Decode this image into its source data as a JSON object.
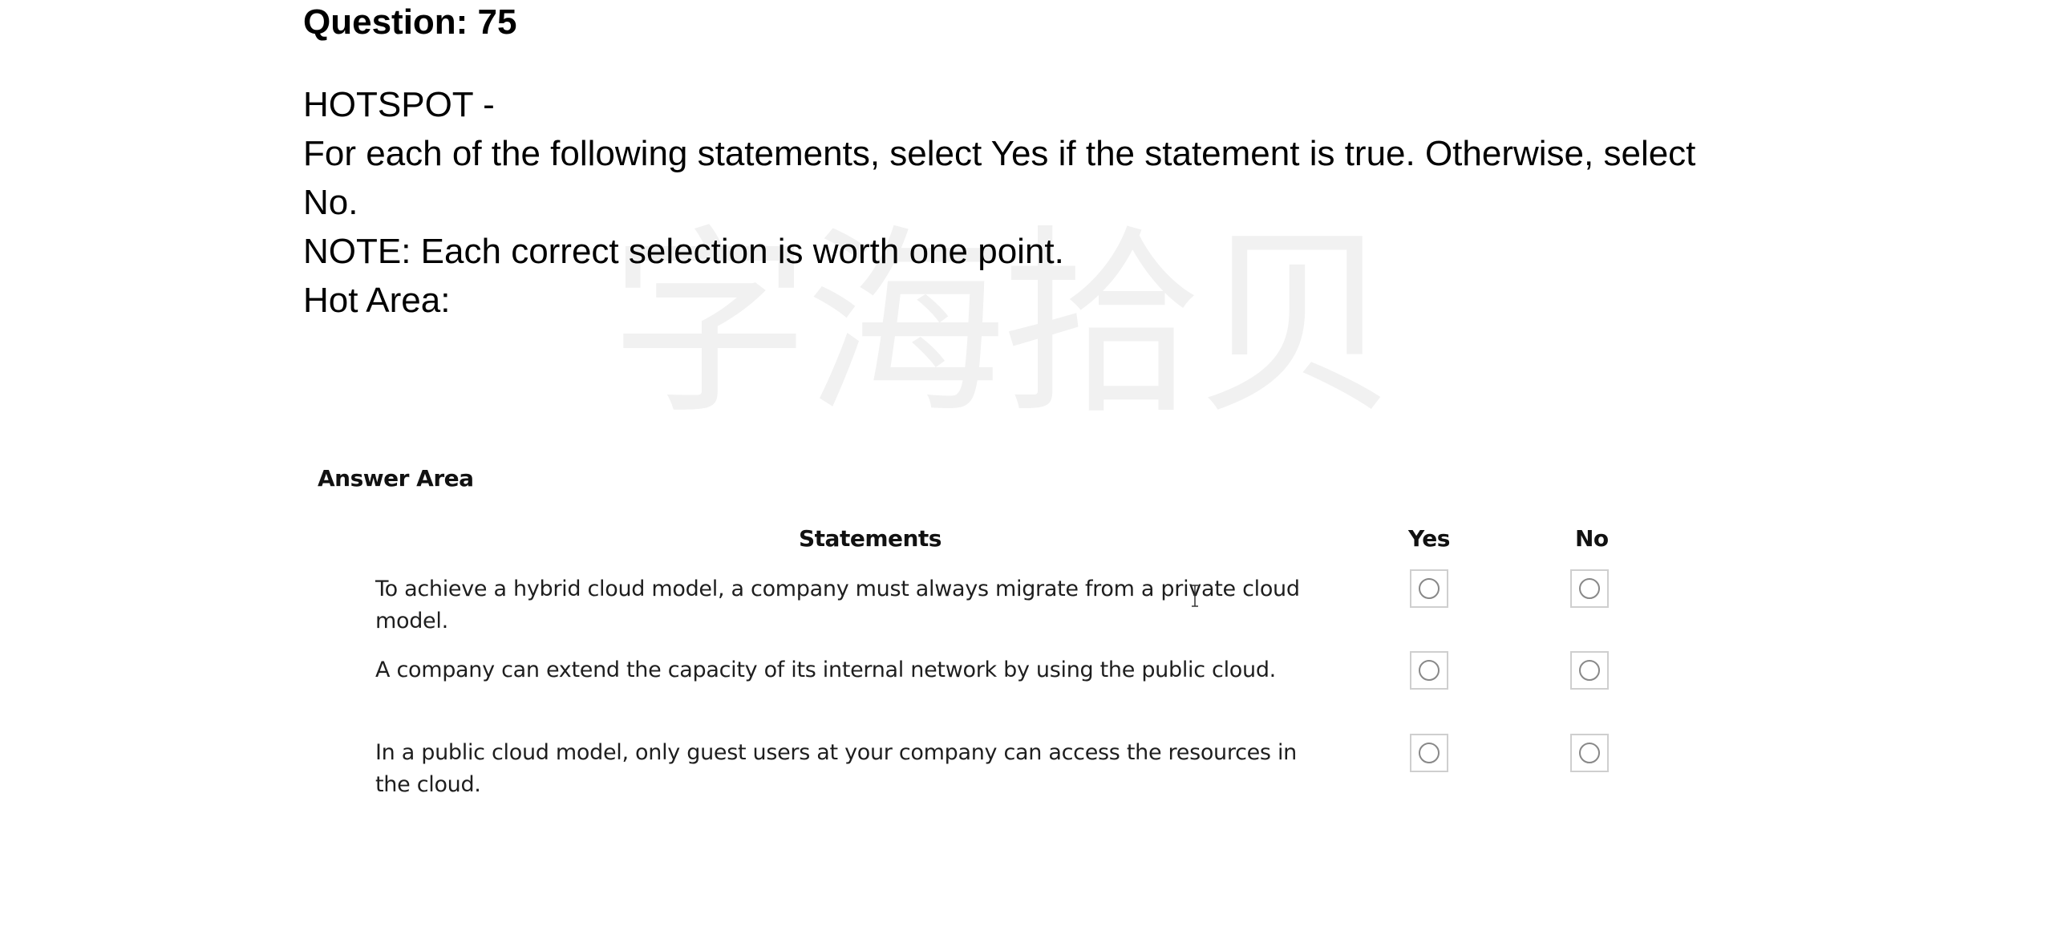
{
  "question": {
    "title": "Question: 75",
    "type_line": "HOTSPOT -",
    "instruction": "For each of the following statements, select Yes if the statement is true. Otherwise, select No.",
    "note": "NOTE: Each correct selection is worth one point.",
    "hot_area_label": "Hot Area:"
  },
  "answer_area": {
    "label": "Answer Area",
    "headers": {
      "statements": "Statements",
      "yes": "Yes",
      "no": "No"
    },
    "statements": [
      {
        "text": "To achieve a hybrid cloud model, a company must always migrate from a private cloud model."
      },
      {
        "text": "A company can extend the capacity of its internal network by using the public cloud."
      },
      {
        "text": "In a public cloud model, only guest users at your company can access the resources in the cloud."
      }
    ]
  },
  "watermark": {
    "text": "字海拾贝"
  },
  "colors": {
    "text": "#000000",
    "statement_text": "#1e1e1e",
    "radio_border": "#cfcfcf",
    "watermark": "#f1f1f1"
  },
  "icons": {
    "radio": "radio-unchecked-icon",
    "cursor": "text-cursor-icon"
  }
}
